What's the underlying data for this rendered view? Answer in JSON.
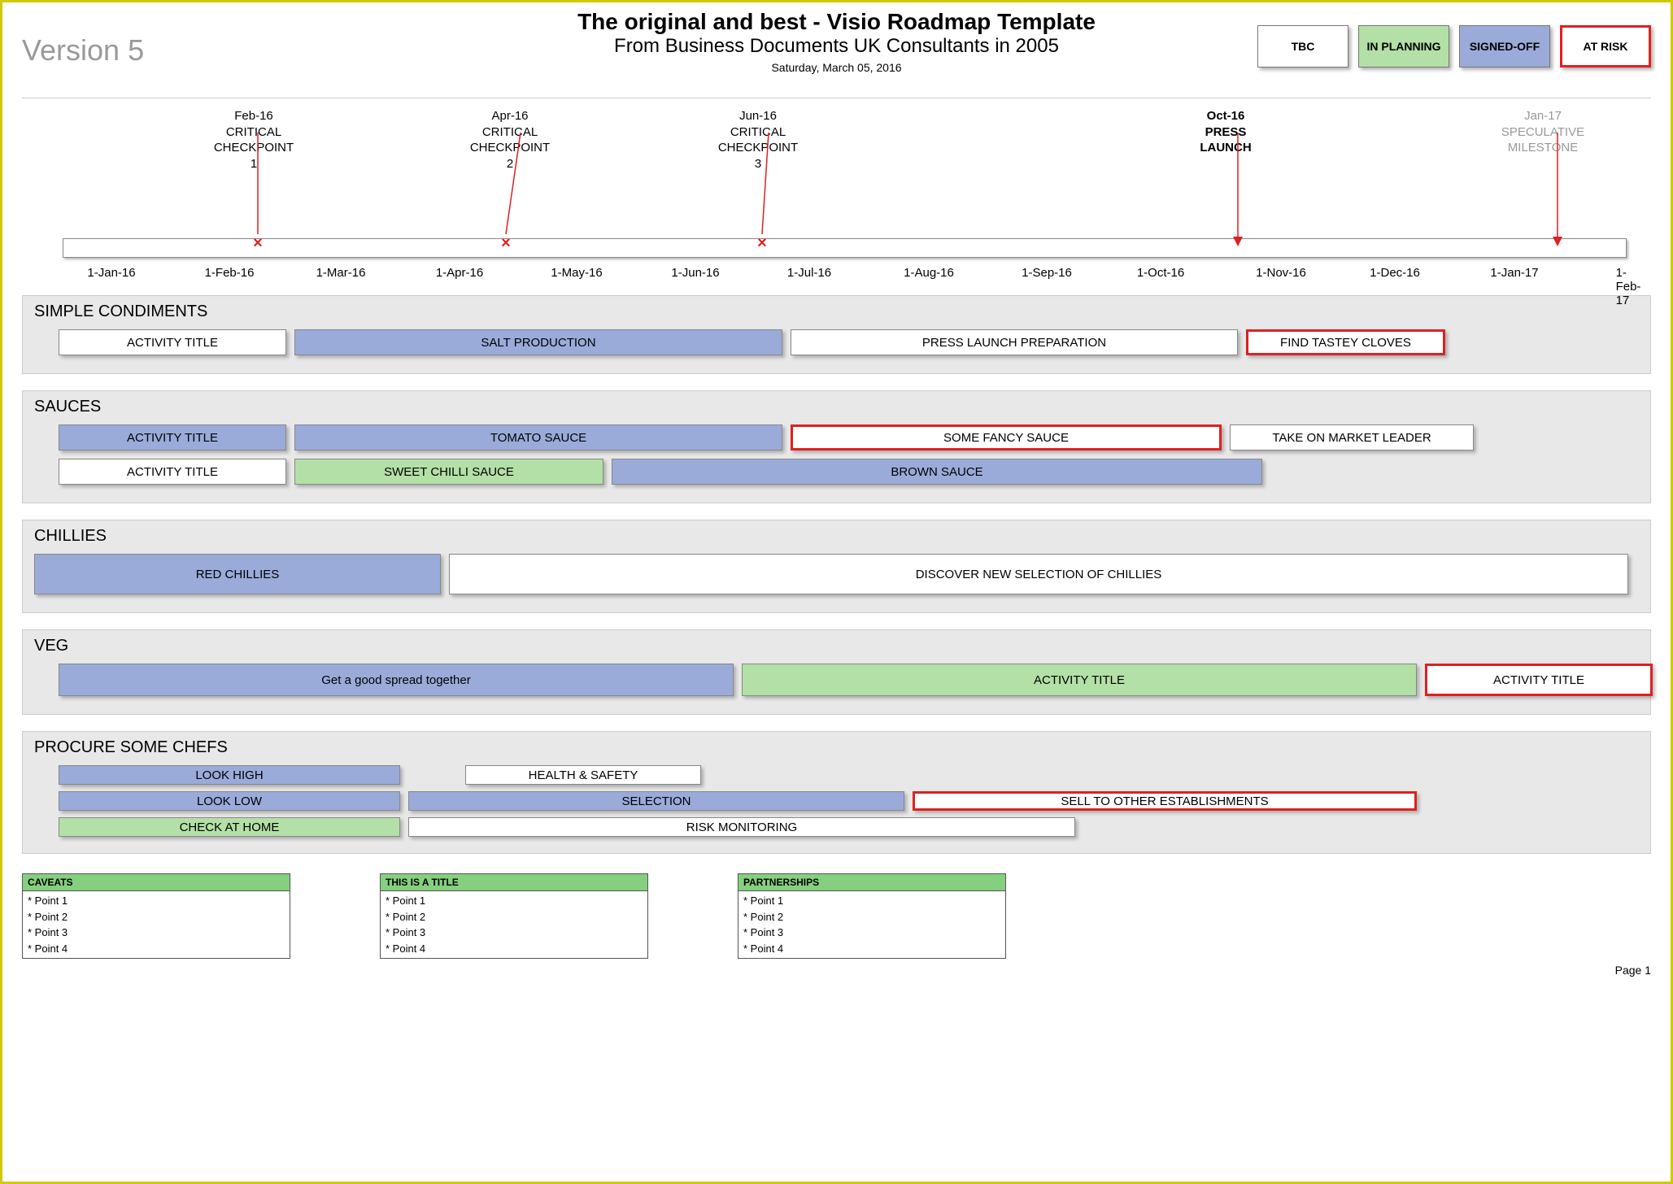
{
  "version": "Version 5",
  "title1": "The original and best - Visio Roadmap Template",
  "title2": "From Business Documents UK Consultants in 2005",
  "date": "Saturday, March 05, 2016",
  "legend": {
    "tbc": "TBC",
    "plan": "IN PLANNING",
    "sign": "SIGNED-OFF",
    "risk": "AT RISK"
  },
  "milestones": [
    {
      "date": "Feb-16",
      "l1": "CRITICAL",
      "l2": "CHECKPOINT",
      "l3": "1"
    },
    {
      "date": "Apr-16",
      "l1": "CRITICAL",
      "l2": "CHECKPOINT",
      "l3": "2"
    },
    {
      "date": "Jun-16",
      "l1": "CRITICAL",
      "l2": "CHECKPOINT",
      "l3": "3"
    },
    {
      "date": "Oct-16",
      "l1": "PRESS",
      "l2": "LAUNCH",
      "l3": ""
    },
    {
      "date": "Jan-17",
      "l1": "SPECULATIVE",
      "l2": "MILESTONE",
      "l3": ""
    }
  ],
  "ticks": [
    "1-Jan-16",
    "1-Feb-16",
    "1-Mar-16",
    "1-Apr-16",
    "1-May-16",
    "1-Jun-16",
    "1-Jul-16",
    "1-Aug-16",
    "1-Sep-16",
    "1-Oct-16",
    "1-Nov-16",
    "1-Dec-16",
    "1-Jan-17",
    "1-Feb-17"
  ],
  "swim": {
    "simple": {
      "title": "SIMPLE CONDIMENTS",
      "bars": [
        {
          "label": "ACTIVITY TITLE"
        },
        {
          "label": "SALT PRODUCTION"
        },
        {
          "label": "PRESS LAUNCH PREPARATION"
        },
        {
          "label": "FIND TASTEY CLOVES"
        }
      ]
    },
    "sauces": {
      "title": "SAUCES",
      "r1": [
        {
          "label": "ACTIVITY TITLE"
        },
        {
          "label": "TOMATO SAUCE"
        },
        {
          "label": "SOME FANCY SAUCE"
        },
        {
          "label": "TAKE ON MARKET LEADER"
        }
      ],
      "r2": [
        {
          "label": "ACTIVITY TITLE"
        },
        {
          "label": "SWEET CHILLI SAUCE"
        },
        {
          "label": "BROWN SAUCE"
        }
      ]
    },
    "chillies": {
      "title": "CHILLIES",
      "bars": [
        {
          "label": "RED CHILLIES"
        },
        {
          "label": "DISCOVER NEW SELECTION OF CHILLIES"
        }
      ]
    },
    "veg": {
      "title": "VEG",
      "bars": [
        {
          "label": "Get a good spread together"
        },
        {
          "label": "ACTIVITY TITLE"
        },
        {
          "label": "ACTIVITY TITLE"
        }
      ]
    },
    "chefs": {
      "title": "PROCURE SOME CHEFS",
      "r1": [
        {
          "label": "LOOK HIGH"
        },
        {
          "label": "HEALTH & SAFETY"
        }
      ],
      "r2": [
        {
          "label": "LOOK LOW"
        },
        {
          "label": "SELECTION"
        },
        {
          "label": "SELL TO OTHER ESTABLISHMENTS"
        }
      ],
      "r3": [
        {
          "label": "CHECK AT HOME"
        },
        {
          "label": "RISK MONITORING"
        }
      ]
    }
  },
  "footer": [
    {
      "title": "CAVEATS",
      "pts": [
        "* Point 1",
        "* Point 2",
        "* Point 3",
        "* Point 4"
      ]
    },
    {
      "title": "THIS IS A TITLE",
      "pts": [
        "* Point 1",
        "* Point 2",
        "* Point 3",
        "* Point 4"
      ]
    },
    {
      "title": "PARTNERSHIPS",
      "pts": [
        "* Point 1",
        "* Point 2",
        "* Point 3",
        "* Point 4"
      ]
    }
  ],
  "page": "Page 1"
}
